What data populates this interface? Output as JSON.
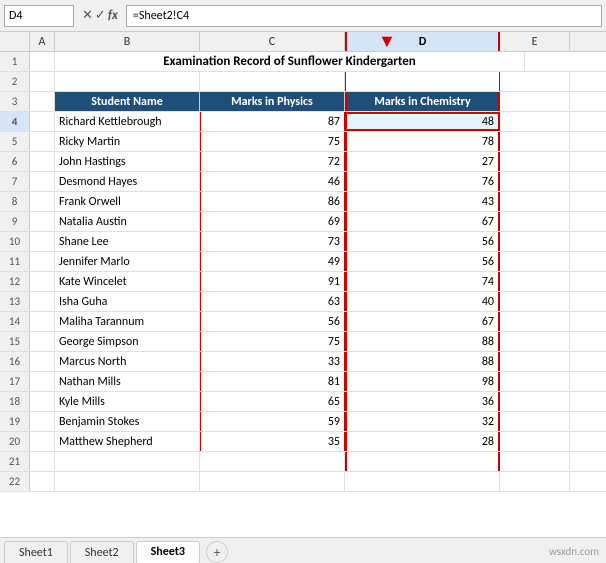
{
  "namebox": {
    "value": "D4"
  },
  "formulabar": {
    "value": "=Sheet2!C4"
  },
  "columns": [
    "A",
    "B",
    "C",
    "D",
    "E"
  ],
  "title": "Examination Record of Sunflower Kindergarten",
  "headers": {
    "student": "Student Name",
    "physics": "Marks in Physics",
    "chemistry": "Marks in Chemistry"
  },
  "students": [
    {
      "name": "Richard Kettlebrough",
      "physics": 87,
      "chemistry": 48
    },
    {
      "name": "Ricky Martin",
      "physics": 75,
      "chemistry": 78
    },
    {
      "name": "John Hastings",
      "physics": 72,
      "chemistry": 27
    },
    {
      "name": "Desmond Hayes",
      "physics": 46,
      "chemistry": 76
    },
    {
      "name": "Frank Orwell",
      "physics": 86,
      "chemistry": 43
    },
    {
      "name": "Natalia Austin",
      "physics": 69,
      "chemistry": 67
    },
    {
      "name": "Shane Lee",
      "physics": 73,
      "chemistry": 56
    },
    {
      "name": "Jennifer Marlo",
      "physics": 49,
      "chemistry": 56
    },
    {
      "name": "Kate Wincelet",
      "physics": 91,
      "chemistry": 74
    },
    {
      "name": "Isha Guha",
      "physics": 63,
      "chemistry": 40
    },
    {
      "name": "Maliha Tarannum",
      "physics": 56,
      "chemistry": 67
    },
    {
      "name": "George Simpson",
      "physics": 75,
      "chemistry": 88
    },
    {
      "name": "Marcus North",
      "physics": 33,
      "chemistry": 88
    },
    {
      "name": "Nathan Mills",
      "physics": 81,
      "chemistry": 98
    },
    {
      "name": "Kyle Mills",
      "physics": 65,
      "chemistry": 36
    },
    {
      "name": "Benjamin Stokes",
      "physics": 59,
      "chemistry": 32
    },
    {
      "name": "Matthew Shepherd",
      "physics": 35,
      "chemistry": 28
    }
  ],
  "tabs": [
    "Sheet1",
    "Sheet2",
    "Sheet3"
  ],
  "active_tab": "Sheet3",
  "watermark": "wsxdn.com"
}
